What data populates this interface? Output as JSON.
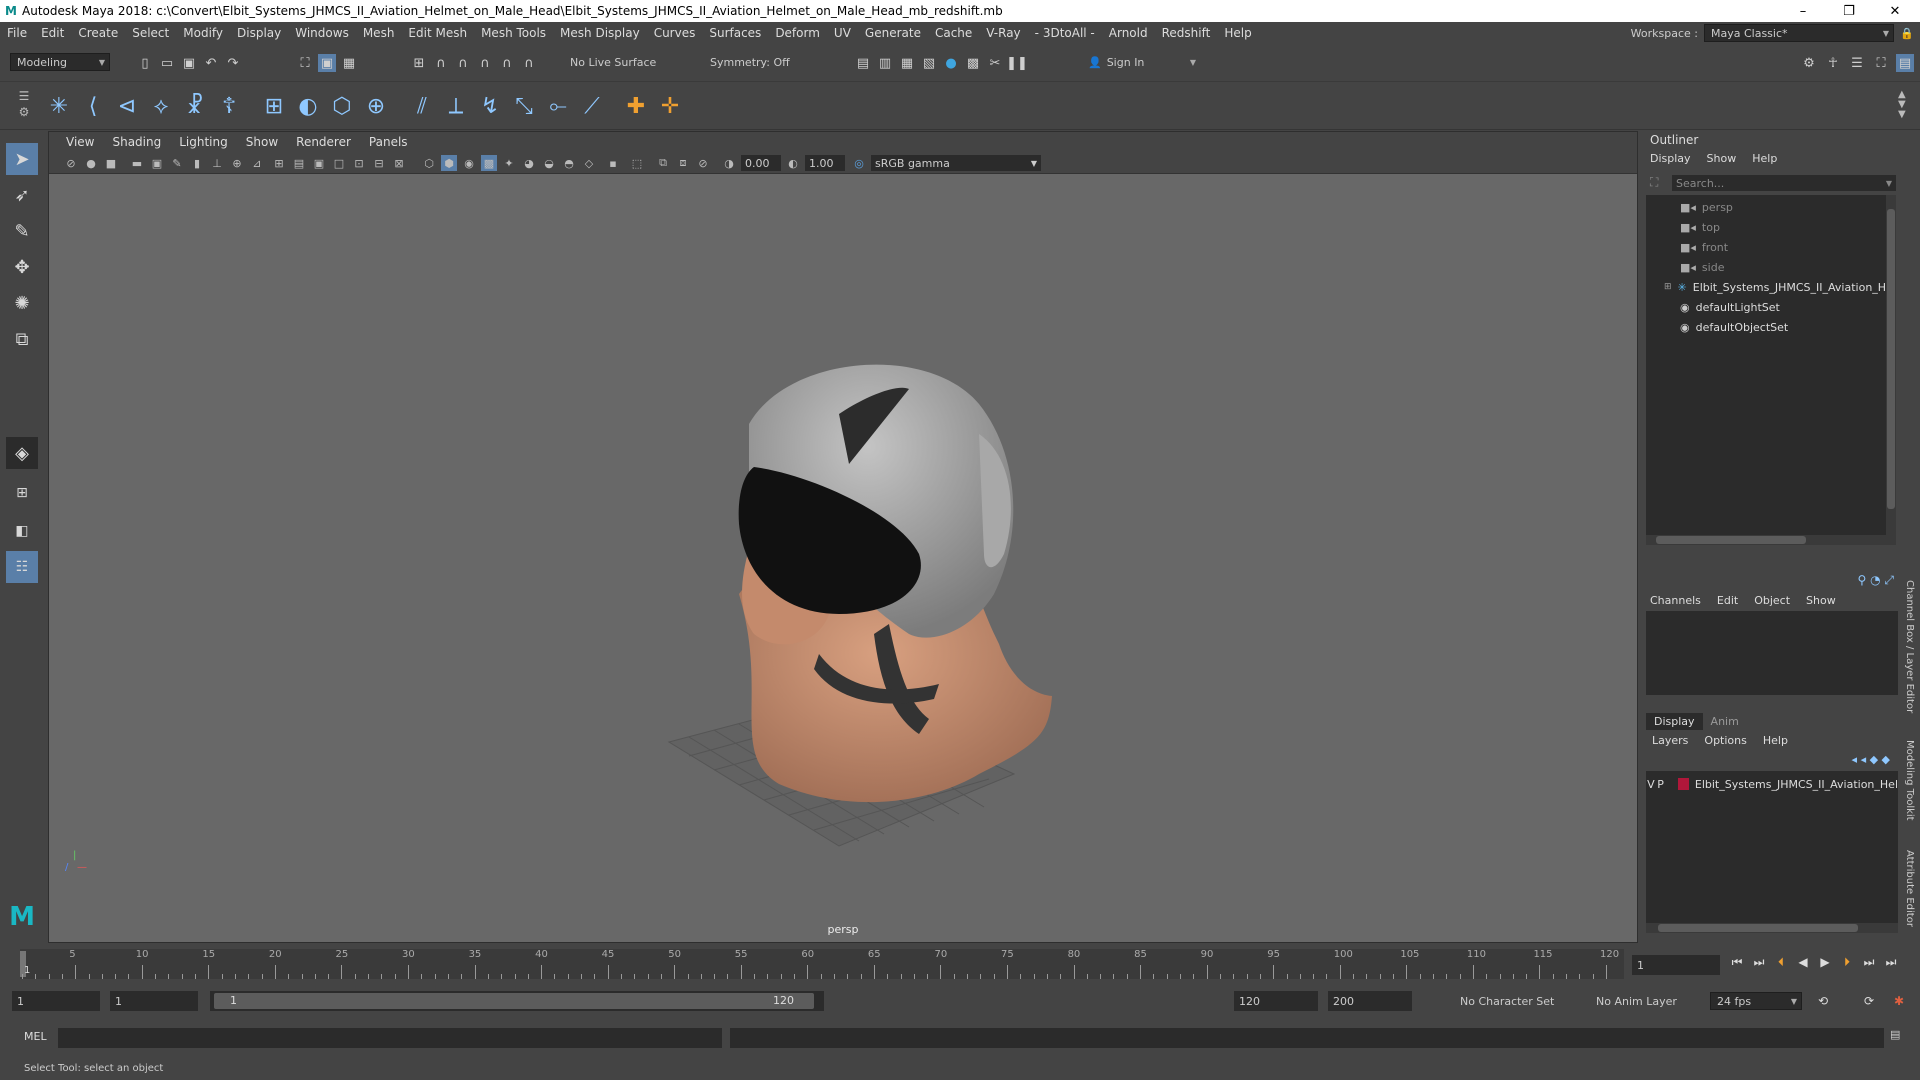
{
  "window": {
    "title": "Autodesk Maya 2018: c:\\Convert\\Elbit_Systems_JHMCS_II_Aviation_Helmet_on_Male_Head\\Elbit_Systems_JHMCS_II_Aviation_Helmet_on_Male_Head_mb_redshift.mb",
    "minimize": "–",
    "maximize": "❐",
    "close": "✕"
  },
  "menubar": {
    "items": [
      "File",
      "Edit",
      "Create",
      "Select",
      "Modify",
      "Display",
      "Windows",
      "Mesh",
      "Edit Mesh",
      "Mesh Tools",
      "Mesh Display",
      "Curves",
      "Surfaces",
      "Deform",
      "UV",
      "Generate",
      "Cache",
      "V-Ray",
      "- 3DtoAll -",
      "Arnold",
      "Redshift",
      "Help"
    ],
    "workspace_label": "Workspace :",
    "workspace_value": "Maya Classic*"
  },
  "statusline": {
    "mode": "Modeling",
    "live_surface": "No Live Surface",
    "symmetry": "Symmetry: Off",
    "sign_in": "Sign In"
  },
  "viewport": {
    "menus": [
      "View",
      "Shading",
      "Lighting",
      "Show",
      "Renderer",
      "Panels"
    ],
    "exposure": "0.00",
    "gamma": "1.00",
    "color_space": "sRGB gamma",
    "camera": "persp"
  },
  "outliner": {
    "title": "Outliner",
    "menus": [
      "Display",
      "Show",
      "Help"
    ],
    "search_placeholder": "Search...",
    "items": [
      {
        "label": "persp",
        "icon": "camera-icon",
        "dim": true
      },
      {
        "label": "top",
        "icon": "camera-icon",
        "dim": true
      },
      {
        "label": "front",
        "icon": "camera-icon",
        "dim": true
      },
      {
        "label": "side",
        "icon": "camera-icon",
        "dim": true
      },
      {
        "label": "Elbit_Systems_JHMCS_II_Aviation_Helmet",
        "icon": "group-icon",
        "dim": false
      },
      {
        "label": "defaultLightSet",
        "icon": "set-icon",
        "dim": false
      },
      {
        "label": "defaultObjectSet",
        "icon": "set-icon",
        "dim": false
      }
    ]
  },
  "channelbox": {
    "menus": [
      "Channels",
      "Edit",
      "Object",
      "Show"
    ],
    "tabs": [
      "Display",
      "Anim"
    ],
    "layer_menus": [
      "Layers",
      "Options",
      "Help"
    ],
    "layer": {
      "v": "V",
      "p": "P",
      "name": "Elbit_Systems_JHMCS_II_Aviation_Hel",
      "color": "#b0173a"
    },
    "side_tabs": [
      "Channel Box / Layer Editor",
      "Modeling Toolkit",
      "Attribute Editor"
    ]
  },
  "timeline": {
    "ticks": [
      "5",
      "10",
      "15",
      "20",
      "25",
      "30",
      "35",
      "40",
      "45",
      "50",
      "55",
      "60",
      "65",
      "70",
      "75",
      "80",
      "85",
      "90",
      "95",
      "100",
      "105",
      "110",
      "115",
      "120"
    ],
    "start_marker": "1",
    "current_frame": "1"
  },
  "range": {
    "start": "1",
    "playback_start": "1",
    "slider_start": "1",
    "slider_end": "120",
    "playback_end": "120",
    "end": "200",
    "character_set": "No Character Set",
    "anim_layer": "No Anim Layer",
    "fps": "24 fps"
  },
  "command": {
    "lang": "MEL"
  },
  "help_line": "Select Tool: select an object"
}
